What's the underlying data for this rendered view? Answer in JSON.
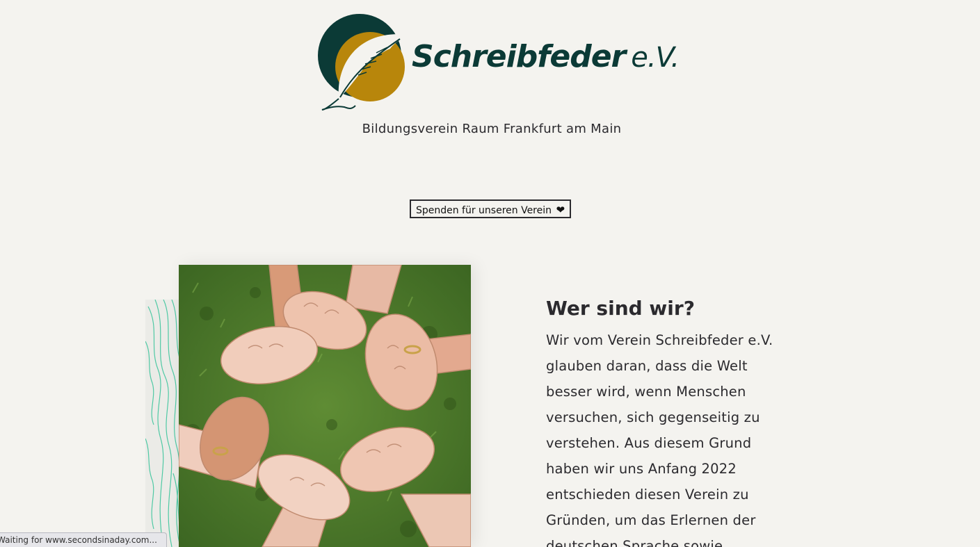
{
  "header": {
    "logo_name": "Schreibfeder",
    "logo_suffix": "e.V.",
    "tagline": "Bildungsverein Raum Frankfurt am Main"
  },
  "donate": {
    "label": "Spenden für unseren Verein",
    "icon": "heart-icon",
    "icon_glyph": "❤"
  },
  "about": {
    "title": "Wer sind wir?",
    "text": "Wir vom Verein Schreibfeder e.V. glauben daran, dass die Welt besser wird, wenn Menschen versuchen, sich gegenseitig zu verstehen. Aus diesem Grund haben wir uns Anfang 2022 entschieden diesen Verein zu Gründen, um das Erlernen der deutschen Sprache sowie"
  },
  "statusbar": {
    "text": "Waiting for www.secondsinaday.com..."
  },
  "colors": {
    "background": "#f4f3ef",
    "brand_green": "#0b3a36",
    "brand_gold": "#b8860b",
    "deco_line": "#4fc9a4"
  }
}
